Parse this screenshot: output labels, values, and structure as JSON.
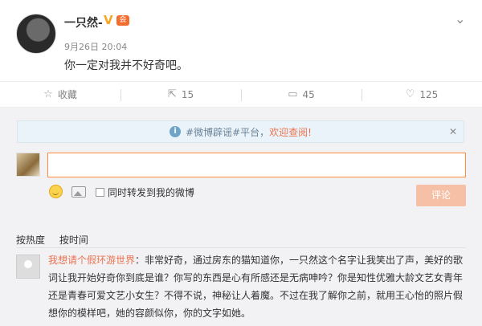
{
  "post": {
    "username": "一只然-",
    "verified_icon": "V",
    "member_icon": "会",
    "date": "9月26日",
    "time": "20:04",
    "text": "你一定对我并不好奇吧。"
  },
  "actions": [
    {
      "icon": "star-icon",
      "label": "收藏"
    },
    {
      "icon": "share-icon",
      "label": "15"
    },
    {
      "icon": "comment-icon",
      "label": "45"
    },
    {
      "icon": "like-icon",
      "label": "125"
    }
  ],
  "notice": {
    "tag": "#微博辟谣#平台，",
    "welcome": "欢迎查阅!"
  },
  "comment_form": {
    "forward_label": "同时转发到我的微博",
    "submit_label": "评论"
  },
  "sort": {
    "hot": "按热度",
    "time": "按时间"
  },
  "comment": {
    "author": "我想请个假环游世界",
    "text": "：非常好奇，通过房东的猫知道你，一只然这个名字让我笑出了声，美好的歌词让我开始好奇你到底是谁？你写的东西是心有所感还是无病呻吟？你是知性优雅大龄文艺女青年还是青春可爱文艺小女生？不得不说，神秘让人着魔。不过在我了解你之前，就用王心怡的照片假想你的模样吧，她的容颜似你，你的文字如她。"
  },
  "colors": {
    "accent": "#eb7350",
    "submit_disabled": "#f5c0a6",
    "notice_bg": "#eaf3f9"
  }
}
